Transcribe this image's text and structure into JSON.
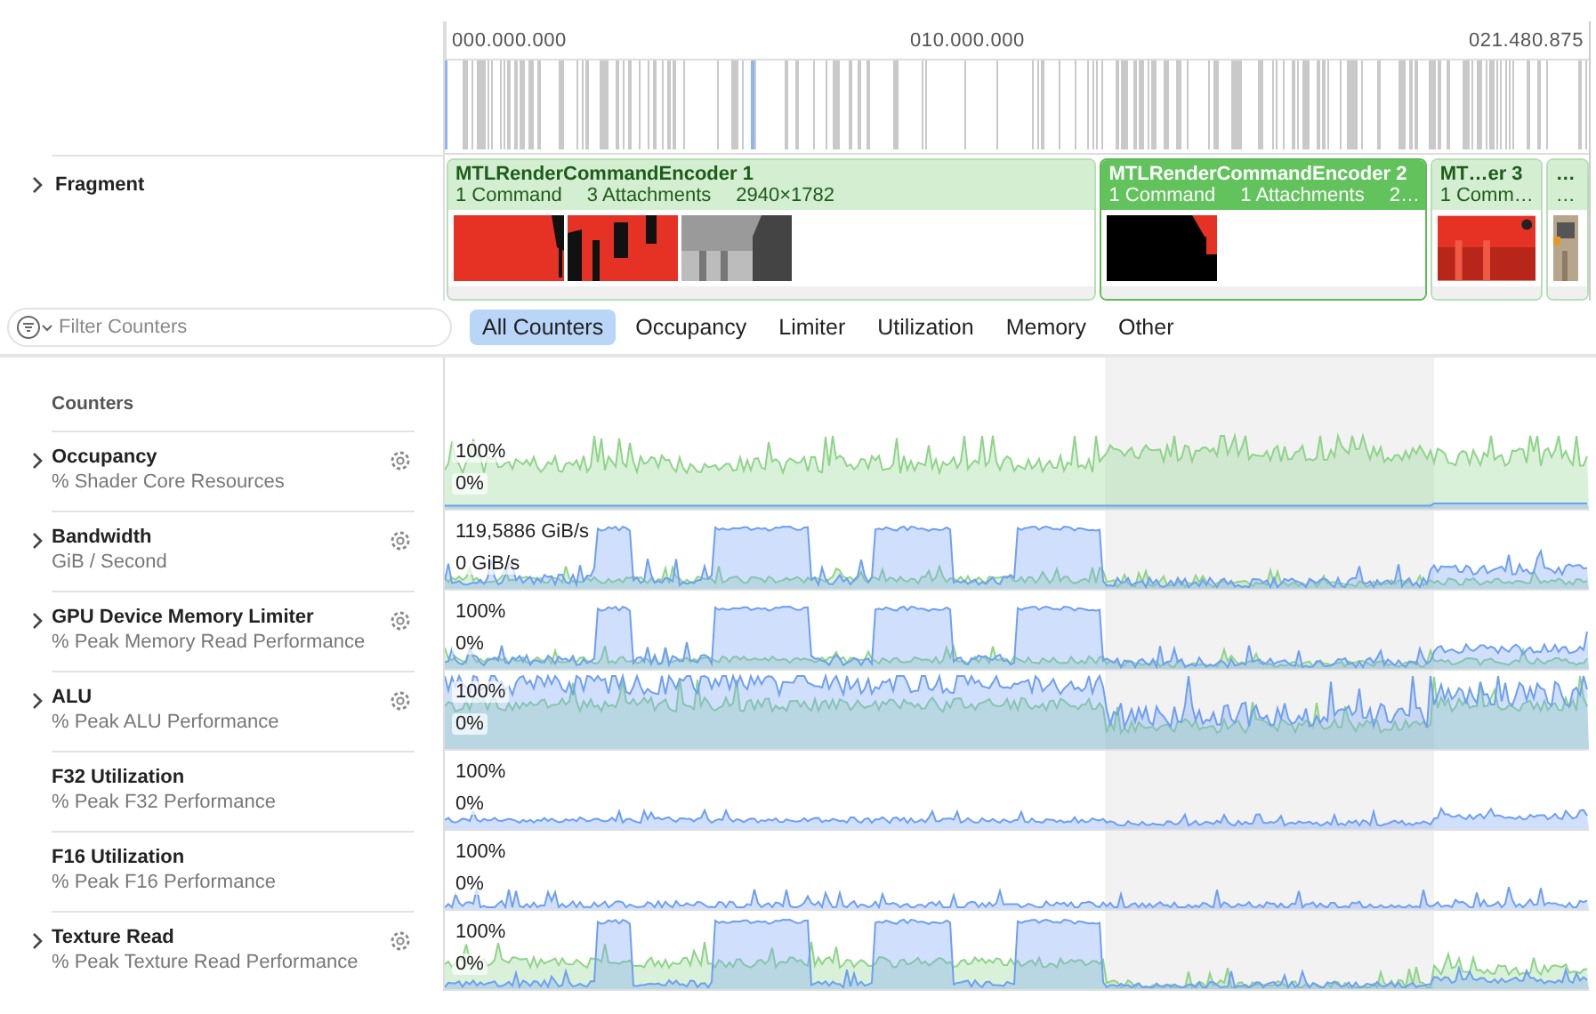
{
  "timeline": {
    "ticks": [
      "000.000.000",
      "010.000.000",
      "021.480.875"
    ]
  },
  "fragment": {
    "label": "Fragment",
    "expanded": false,
    "encoders": [
      {
        "title": "MTLRenderCommandEncoder 1",
        "details": [
          "1 Command",
          "3 Attachments",
          "2940×1782"
        ],
        "selected": false,
        "thumbnails": [
          {
            "kind": "picture"
          },
          {
            "kind": "picture"
          },
          {
            "kind": "picture"
          }
        ]
      },
      {
        "title": "MTLRenderCommandEncoder 2",
        "details": [
          "1 Command",
          "1 Attachments",
          "2…"
        ],
        "selected": true,
        "thumbnails": [
          {
            "kind": "picture"
          }
        ]
      },
      {
        "title": "MT…er 3",
        "details": [
          "1 Comm…"
        ],
        "selected": false,
        "thumbnails": [
          {
            "kind": "picture"
          }
        ]
      },
      {
        "title": "…",
        "details": [
          "…"
        ],
        "selected": false,
        "thumbnails": [
          {
            "kind": "picture"
          }
        ]
      }
    ]
  },
  "filter": {
    "placeholder": "Filter Counters"
  },
  "tabs": [
    {
      "label": "All Counters",
      "selected": true
    },
    {
      "label": "Occupancy",
      "selected": false
    },
    {
      "label": "Limiter",
      "selected": false
    },
    {
      "label": "Utilization",
      "selected": false
    },
    {
      "label": "Memory",
      "selected": false
    },
    {
      "label": "Other",
      "selected": false
    }
  ],
  "counters_header": "Counters",
  "counters": [
    {
      "name": "Occupancy",
      "unit": "% Shader Core Resources",
      "expandable": true,
      "configurable": true,
      "max": "100%",
      "min": "0%"
    },
    {
      "name": "Bandwidth",
      "unit": "GiB / Second",
      "expandable": true,
      "configurable": true,
      "max": "119,5886 GiB/s",
      "min": "0 GiB/s"
    },
    {
      "name": "GPU Device Memory Limiter",
      "unit": "% Peak Memory Read Performance",
      "expandable": true,
      "configurable": true,
      "max": "100%",
      "min": "0%"
    },
    {
      "name": "ALU",
      "unit": "% Peak ALU Performance",
      "expandable": true,
      "configurable": true,
      "max": "100%",
      "min": "0%"
    },
    {
      "name": "F32 Utilization",
      "unit": "% Peak F32 Performance",
      "expandable": false,
      "configurable": false,
      "max": "100%",
      "min": "0%"
    },
    {
      "name": "F16 Utilization",
      "unit": "% Peak F16 Performance",
      "expandable": false,
      "configurable": false,
      "max": "100%",
      "min": "0%"
    },
    {
      "name": "Texture Read",
      "unit": "% Peak Texture Read Performance",
      "expandable": true,
      "configurable": true,
      "max": "100%",
      "min": "0%"
    }
  ]
}
